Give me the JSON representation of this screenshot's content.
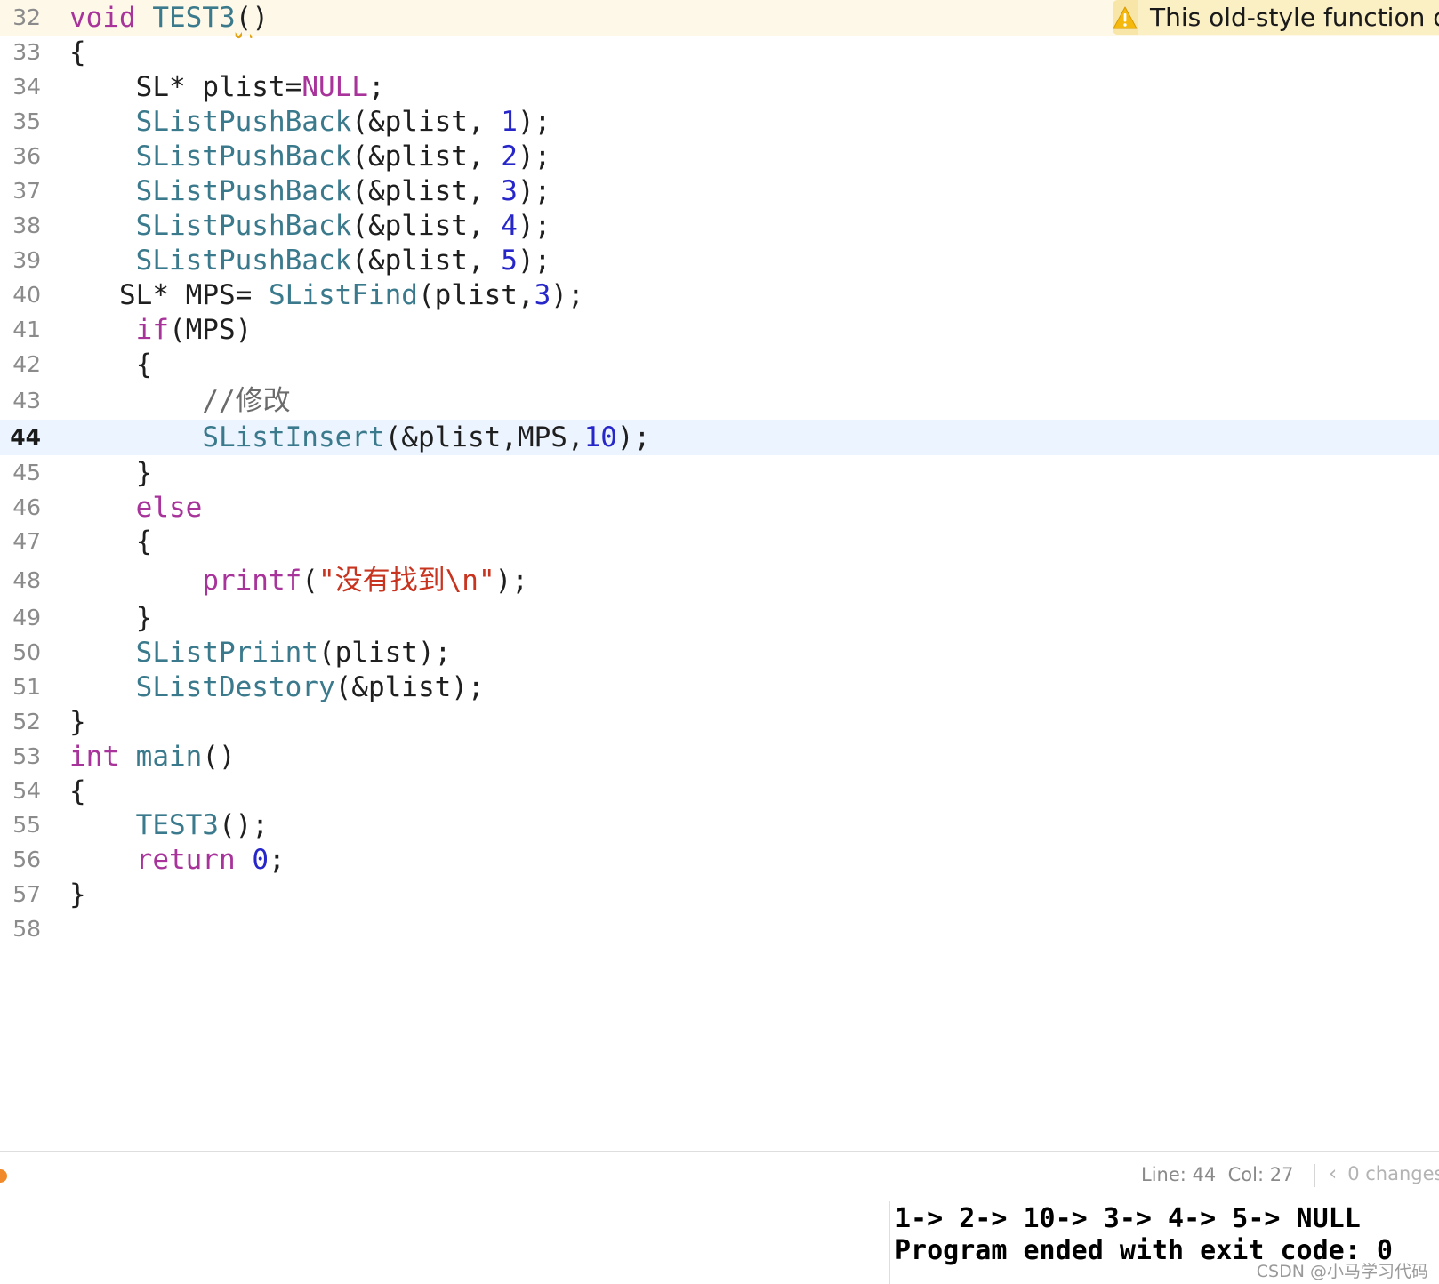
{
  "editor": {
    "line_numbers": [
      "32",
      "33",
      "34",
      "35",
      "36",
      "37",
      "38",
      "39",
      "40",
      "41",
      "42",
      "43",
      "44",
      "45",
      "46",
      "47",
      "48",
      "49",
      "50",
      "51",
      "52",
      "53",
      "54",
      "55",
      "56",
      "57",
      "58"
    ],
    "current_line": "44",
    "tokens": {
      "void": "void",
      "test3_decl": "TEST3",
      "test3_decl_paren_open": "(",
      "test3_decl_paren_close": ")",
      "open_brace": "{",
      "close_brace": "}",
      "sl_type": "SL*",
      "plist_decl": " plist=",
      "null": "NULL",
      "semicolon": ";",
      "push_back": "SListPushBack",
      "push_args": "(&plist, ",
      "n1": "1",
      "n2": "2",
      "n3": "3",
      "n4": "4",
      "n5": "5",
      "call_end": ");",
      "mps_decl": " MPS= ",
      "find": "SListFind",
      "find_args": "(plist,",
      "if": "if",
      "if_cond": "(MPS)",
      "comment": "//修改",
      "insert": "SListInsert",
      "insert_args": "(&plist,MPS,",
      "n10": "10",
      "else": "else",
      "printf": "printf",
      "paren_open": "(",
      "printf_str": "\"没有找到\\n\"",
      "print_list": "SListPriint",
      "print_list_args": "(plist);",
      "destroy": "SListDestory",
      "destroy_args": "(&plist);",
      "int": "int",
      "main": "main",
      "empty_parens": "()",
      "test3_call": "TEST3",
      "test3_call_args": "();",
      "return": "return",
      "zero": "0"
    }
  },
  "warning": {
    "icon": "warning-triangle-icon",
    "text": "This old-style function definition is not preceded by a prototype"
  },
  "status_bar": {
    "line_label": "Line: 44",
    "col_label": "Col: 27",
    "changes_label": "0 changes",
    "chevron": "‹",
    "indicator_color": "#f08a2a"
  },
  "console": {
    "lines": [
      "1-> 2-> 10-> 3-> 4-> 5-> NULL",
      "Program ended with exit code: 0"
    ]
  },
  "watermark": "CSDN @小马学习代码",
  "colors": {
    "keyword": "#a8349b",
    "function": "#3a7a8c",
    "number": "#2727c9",
    "string": "#c7341f",
    "current_line_bg": "#ecf4ff",
    "warning_bg": "#fbefc4"
  }
}
